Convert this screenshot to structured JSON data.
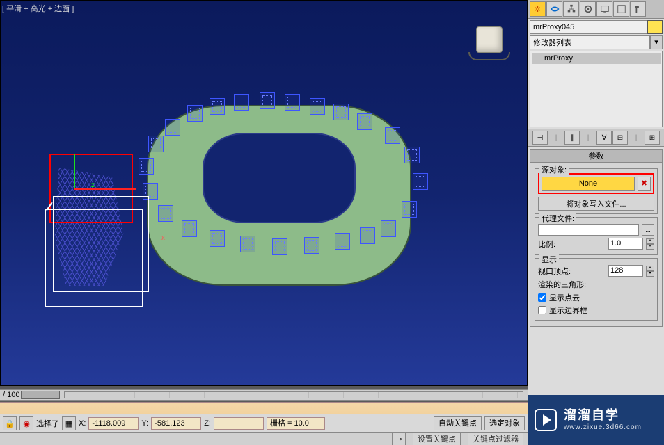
{
  "viewport": {
    "label": "[ 平滑 + 高光 + 边面 ]",
    "axis_x": "x",
    "axis_z": "z"
  },
  "command_panel": {
    "tabs": [
      "create",
      "modify",
      "hierarchy",
      "motion",
      "display",
      "utilities",
      "hammer"
    ]
  },
  "object": {
    "name": "mrProxy045"
  },
  "modifier": {
    "dropdown": "修改器列表",
    "stack_item": "mrProxy"
  },
  "rollouts": {
    "params_title": "参数",
    "source_group": "源对象:",
    "none_button": "None",
    "write_to_file": "将对象写入文件...",
    "proxy_file_group": "代理文件:",
    "scale_label": "比例:",
    "scale_value": "1.0",
    "display_group": "显示",
    "viewport_verts_label": "视口顶点:",
    "viewport_verts_value": "128",
    "render_tris_label": "渲染的三角形:",
    "show_point_cloud": "显示点云",
    "show_bbox": "显示边界框"
  },
  "timeline": {
    "label": "/ 100"
  },
  "status": {
    "selected_label": "选择了",
    "x_label": "X:",
    "x_value": "-1118.009",
    "y_label": "Y:",
    "y_value": "-581.123",
    "z_label": "Z:",
    "grid_label": "栅格 = 10.0",
    "autokey": "自动关键点",
    "selected_obj": "选定对象",
    "setkey": "设置关键点",
    "keyfilter": "关键点过滤器"
  },
  "logo": {
    "cn": "溜溜自学",
    "en": "www.zixue.3d66.com"
  }
}
